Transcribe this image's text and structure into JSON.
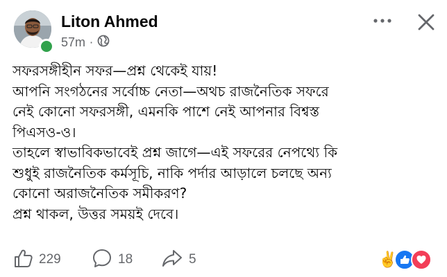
{
  "post": {
    "author": "Liton Ahmed",
    "time": "57m",
    "separator": "·",
    "audience_icon": "globe-icon",
    "body_lines": [
      "সফরসঙ্গীহীন সফর—প্রশ্ন থেকেই যায়!",
      "আপনি সংগঠনের সর্বোচ্চ নেতা—অথচ রাজনৈতিক সফরে",
      "নেই কোনো সফরসঙ্গী, এমনকি পাশে নেই আপনার বিশ্বস্ত",
      "পিএসও-ও।",
      "তাহলে স্বাভাবিকভাবেই প্রশ্ন জাগে—এই সফরের নেপথ্যে কি",
      "শুধুই রাজনৈতিক কর্মসূচি, নাকি পর্দার আড়ালে চলছে অন্য",
      "কোনো অরাজনৈতিক সমীকরণ?",
      "প্রশ্ন থাকল, উত্তর সময়ই দেবে।"
    ]
  },
  "footer": {
    "likes": "229",
    "comments": "18",
    "shares": "5",
    "reaction_emoji": "✌️"
  },
  "colors": {
    "online": "#31a24c",
    "like_blue": "#1877f2",
    "love_red": "#f33e58",
    "muted": "#65676b"
  }
}
